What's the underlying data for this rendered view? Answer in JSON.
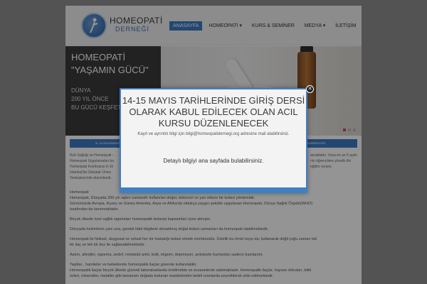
{
  "header": {
    "logo_line1": "HOMEOPATİ",
    "logo_line2": "DERNEĞİ",
    "nav": [
      {
        "label": "ANASAYFA",
        "active": true
      },
      {
        "label": "HOMEOPATİ ▾"
      },
      {
        "label": "KURS & SEMİNER"
      },
      {
        "label": "MEDYA ▾"
      },
      {
        "label": "İLETİŞİM"
      }
    ]
  },
  "slider": {
    "title_line1": "HOMEOPATİ",
    "title_line2": "\"YAŞAMIN GÜCÜ\"",
    "sub_line1": "DÜNYA",
    "sub_line2": "200 YIL ÖNCE",
    "sub_line3": "BU GÜCÜ KEŞFETTİ"
  },
  "boxes": {
    "left": "III. ULUSLARARASI HOMEOPATİ",
    "right": "EĞİTİM SEMİNERLERİ"
  },
  "content": {
    "side_left": [
      "Ruh Sağlığı ve Homeopati –",
      "Homeopati Uygulamaları ba",
      "Homeopati Konferansı 6-10",
      "İstanbul'da Üsküdar Ünive",
      "Yerleşkesi'nde düzenlendi."
    ],
    "side_right": [
      "amaktadır. Veya en az 6 aydır",
      "nin öğrencilere yönelik ilkı",
      "eğitim veriyor."
    ],
    "paragraphs": [
      "Homeopati",
      "Homeopati, Dünyada 200 yılı aşkın zamandır kullanılan doğal, bütüncül ve yan etkisiz bir tedavi yöntemidir.",
      "Günümüzde Avrupa, Kuzey ve Güney Amerika, Asya ve Afrika'da oldukça yaygın şekilde uygulanan Homeopati, Dünya Sağlık Örgütü(WHO)",
      "tarafından da tanınmaktadır.",
      "Birçok ülkede özel sağlık sigortaları homeopatik tedaviyi kapsamları içine almıştır.",
      "Dünyada hekimlerin yanı sıra, gerekli tıbbi bilgilerle donatılmış doğal tedavi uzmanları da homeopati olabilmektedir.",
      "Homeopati ile fiziksel, duygusal ve ruhsal her tür hastalığı tedavi etmek mümkündür. Üstelik bu ömür boyu da; kullanarak değil çoğu zaman tek",
      "bir ilaç ve tek bir doz ile sağlanabilmektedir.",
      "Astım, allerjiler, egzema, sedef, romatoid artrit, kolit, migren, depresyon, anksiyete bunlardan sadece bazılarıdır.",
      "Taşlılar , hamileler ve bebeklerde homeopatik ilaçlar güvenle kullanılabilir.",
      "Homeopatik ilaçlar birçok ülkede güvenli laboratuarlarda üretilmekte ve eczanelerde satılmaktadır. Homeopatik ilaçlar, hayvan dokuları, bitki",
      "özleri, mineraller, metaller gibi tamamen doğada bulunan maddelerden belirli oranlarda seyreltilerek elde edilmektedir."
    ]
  },
  "modal": {
    "heading_line1": "14-15 MAYIS TARİHLERİNDE GİRİŞ DERSİ",
    "heading_line2": "OLARAK KABUL EDİLECEK OLAN ACIL",
    "heading_line3": "KURSU DÜZENLENECEK",
    "subtext": "Kayıt ve ayrıntılı bilgi için bilgi@homeopatidernegi.org adresine mail atabilirsiniz.",
    "body": "Detaylı bilgiyi ana sayfada bulabilirsiniz.",
    "close_label": "✕"
  }
}
